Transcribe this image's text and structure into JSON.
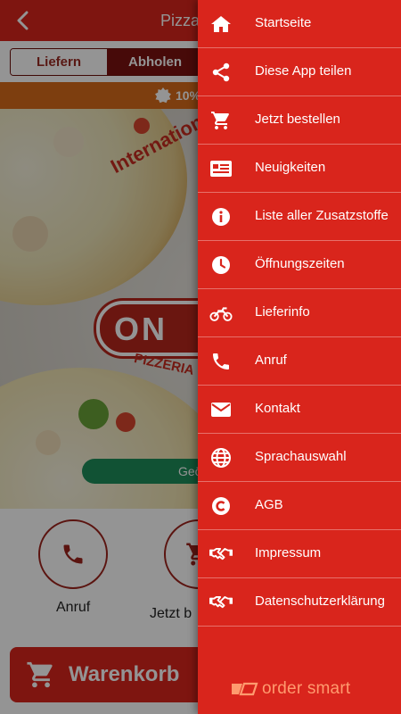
{
  "header": {
    "title": "Pizza"
  },
  "order_mode": {
    "tabs": [
      {
        "label": "Liefern",
        "active": false
      },
      {
        "label": "Abholen",
        "active": true
      }
    ]
  },
  "discount": {
    "text": "10%"
  },
  "hero": {
    "logo_script": "Internationale",
    "logo_main": "ON",
    "logo_sub": "PIZZERIA",
    "status_text": "Geö"
  },
  "quick_actions": [
    {
      "label": "Anruf",
      "icon": "phone-icon"
    },
    {
      "label": "Jetzt b",
      "icon": "cart-icon"
    }
  ],
  "cart": {
    "label": "Warenkorb"
  },
  "drawer": {
    "items": [
      {
        "label": "Startseite",
        "icon": "home-icon"
      },
      {
        "label": "Diese App teilen",
        "icon": "share-icon"
      },
      {
        "label": "Jetzt bestellen",
        "icon": "cart-icon"
      },
      {
        "label": "Neuigkeiten",
        "icon": "news-icon"
      },
      {
        "label": "Liste aller Zusatzstoffe",
        "icon": "info-icon"
      },
      {
        "label": "Öffnungszeiten",
        "icon": "clock-icon"
      },
      {
        "label": "Lieferinfo",
        "icon": "motorcycle-icon"
      },
      {
        "label": "Anruf",
        "icon": "phone-icon"
      },
      {
        "label": "Kontakt",
        "icon": "envelope-icon"
      },
      {
        "label": "Sprachauswahl",
        "icon": "globe-icon"
      },
      {
        "label": "AGB",
        "icon": "copyright-icon"
      },
      {
        "label": "Impressum",
        "icon": "handshake-icon"
      },
      {
        "label": "Datenschutzerklärung",
        "icon": "handshake-icon"
      }
    ],
    "brand": "order smart"
  },
  "colors": {
    "primary": "#d9251c",
    "dark": "#7a1210",
    "discount": "#d86b1a",
    "status": "#1e8d5a",
    "brand": "#ff9a6e"
  }
}
